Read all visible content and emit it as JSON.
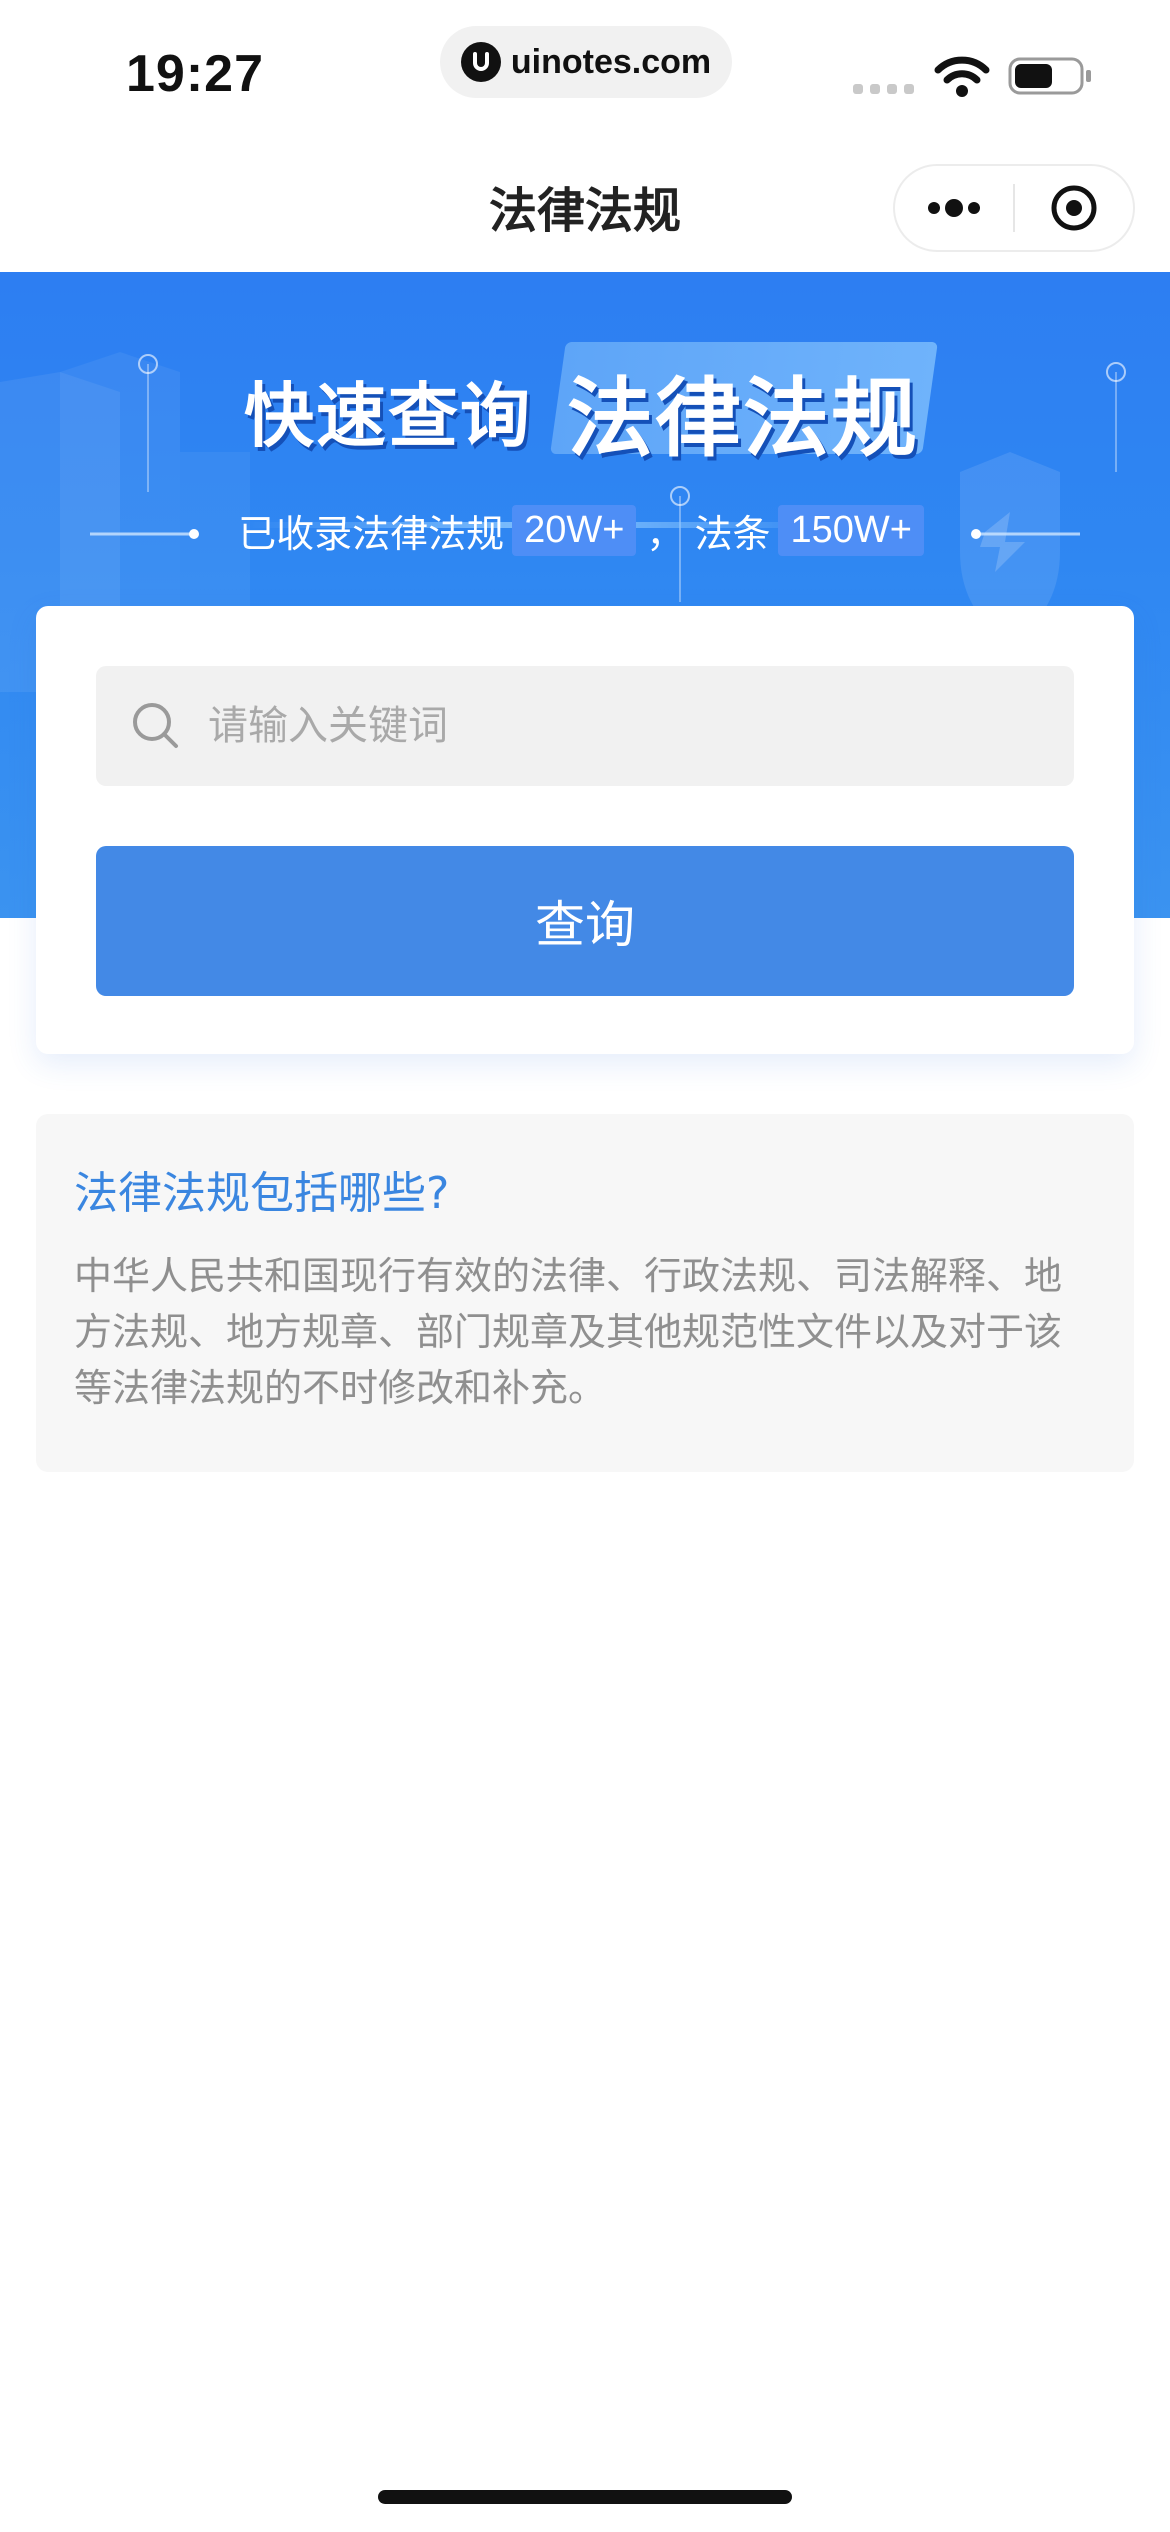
{
  "status_bar": {
    "time": "19:27",
    "url": "uinotes.com",
    "battery_level": 0.6
  },
  "nav": {
    "title": "法律法规",
    "more_icon": "more-dots-icon",
    "close_icon": "target-close-icon"
  },
  "banner": {
    "headline_left": "快速查询",
    "headline_right": "法律法规",
    "stats_prefix": "已收录法律法规",
    "stats_laws": "20W+",
    "stats_separator": "，",
    "stats_mid": "法条",
    "stats_articles": "150W+"
  },
  "search": {
    "placeholder": "请输入关键词",
    "value": "",
    "button_label": "查询"
  },
  "info": {
    "title": "法律法规包括哪些?",
    "body": "中华人民共和国现行有效的法律、行政法规、司法解释、地方法规、地方规章、部门规章及其他规范性文件以及对于该等法律法规的不时修改和补充。"
  },
  "colors": {
    "banner_blue": "#2f87f2",
    "button_blue": "#4389e6",
    "info_title": "#3a86e0",
    "info_body": "#8f8f8f"
  }
}
